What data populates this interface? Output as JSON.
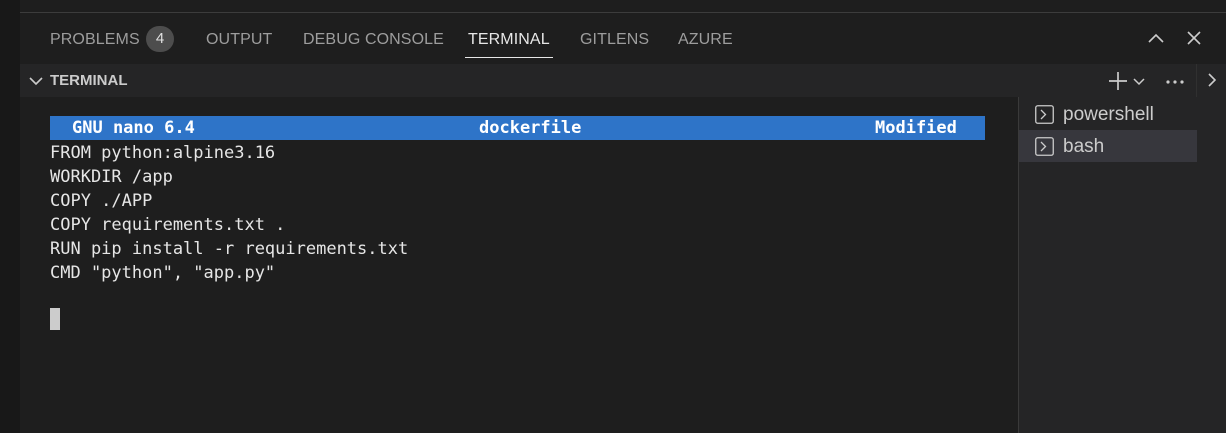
{
  "panel": {
    "tabs": [
      {
        "label": "PROBLEMS",
        "badge": "4"
      },
      {
        "label": "OUTPUT"
      },
      {
        "label": "DEBUG CONSOLE"
      },
      {
        "label": "TERMINAL",
        "active": true
      },
      {
        "label": "GITLENS"
      },
      {
        "label": "AZURE"
      }
    ],
    "actions": {
      "maximize_icon": "chevron-up-icon",
      "close_icon": "close-icon"
    }
  },
  "section": {
    "title": "TERMINAL",
    "actions": {
      "new_icon": "plus-icon",
      "dropdown_icon": "chevron-down-icon",
      "more_icon": "ellipsis-icon"
    }
  },
  "nano": {
    "app": "GNU nano 6.4",
    "filename": "dockerfile",
    "status": "Modified"
  },
  "file_lines": [
    "FROM python:alpine3.16",
    "WORKDIR /app",
    "COPY ./APP",
    "COPY requirements.txt .",
    "RUN pip install -r requirements.txt",
    "CMD \"python\", \"app.py\""
  ],
  "terminals": [
    {
      "label": "powershell",
      "icon": "terminal-icon",
      "active": false
    },
    {
      "label": "bash",
      "icon": "terminal-icon",
      "active": true
    }
  ],
  "colors": {
    "background": "#1e1e1e",
    "header_bg": "#252526",
    "nano_bar": "#2e74c8",
    "active_item": "#37373d"
  }
}
